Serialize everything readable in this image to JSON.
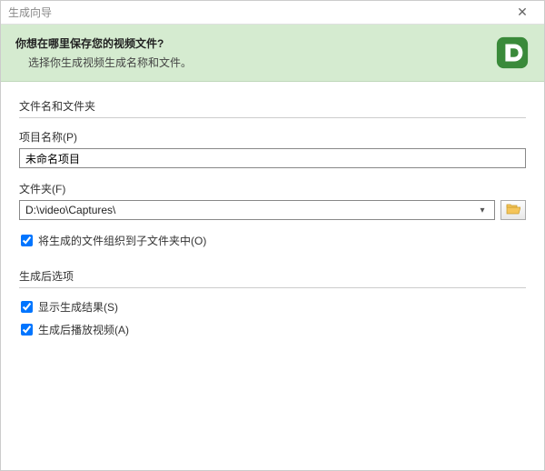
{
  "window": {
    "title": "生成向导"
  },
  "banner": {
    "title": "你想在哪里保存您的视频文件?",
    "subtitle": "选择你生成视频生成名称和文件。"
  },
  "group_file": {
    "title": "文件名和文件夹",
    "project_label": "项目名称(P)",
    "project_value": "未命名项目",
    "folder_label": "文件夹(F)",
    "folder_value": "D:\\video\\Captures\\",
    "organize_label": "将生成的文件组织到子文件夹中(O)",
    "organize_checked": true
  },
  "group_after": {
    "title": "生成后选项",
    "show_result_label": "显示生成结果(S)",
    "show_result_checked": true,
    "play_after_label": "生成后播放视频(A)",
    "play_after_checked": true
  }
}
